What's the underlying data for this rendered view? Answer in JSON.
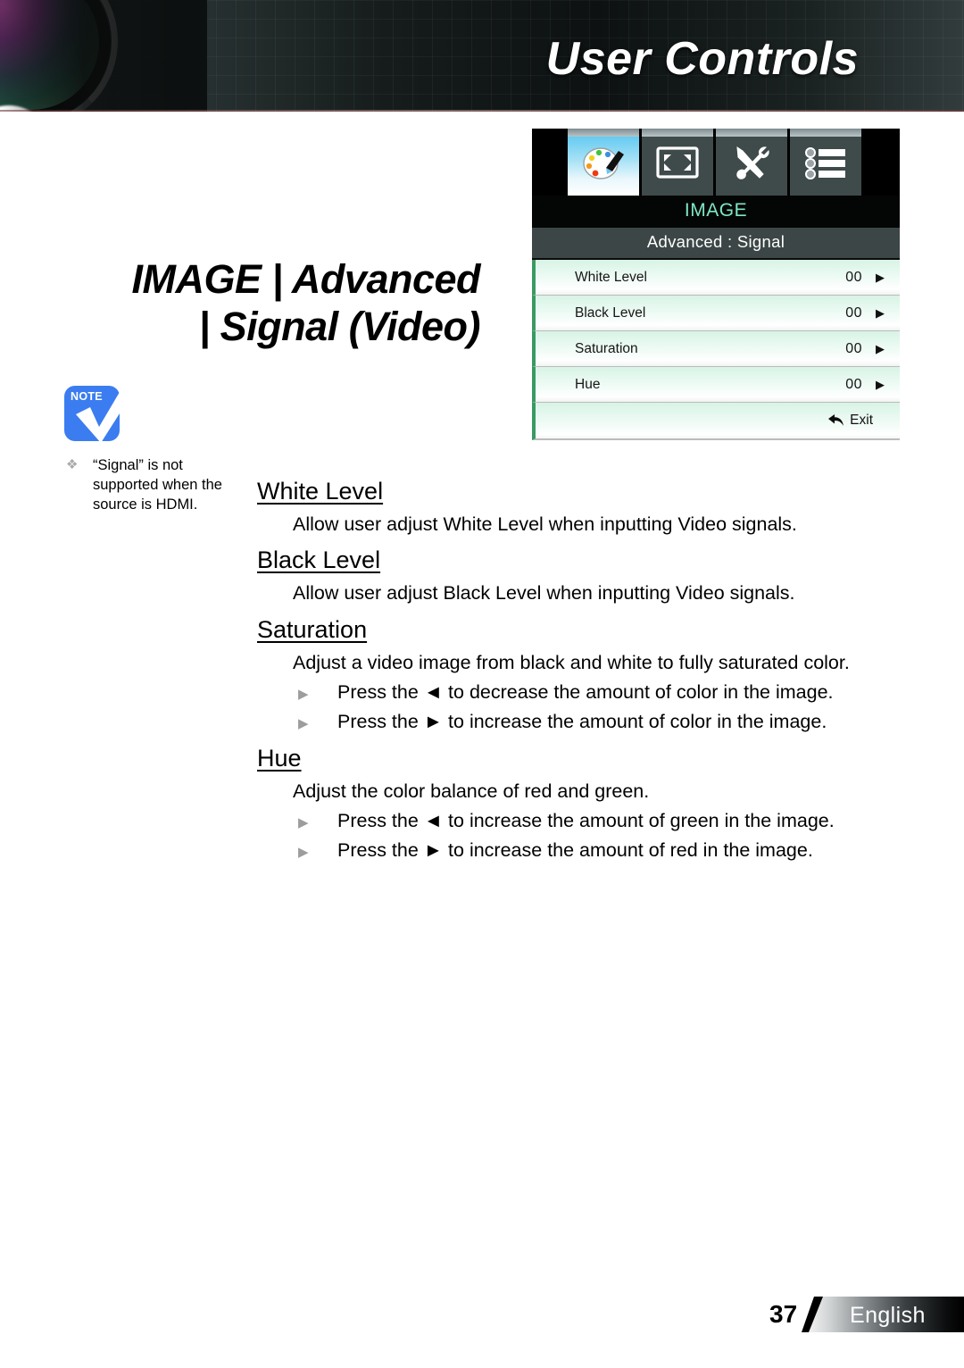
{
  "header": {
    "banner_title": "User Controls"
  },
  "page_title": {
    "line1": "IMAGE | Advanced",
    "line2": "| Signal (Video)"
  },
  "note": {
    "badge_label": "Note",
    "bullet_glyph": "❖",
    "text": "“Signal” is not supported when the source is HDMI."
  },
  "osd": {
    "tabs": [
      {
        "icon": "palette-icon",
        "label": "IMAGE",
        "active": true
      },
      {
        "icon": "screen-icon",
        "label": "DISPLAY",
        "active": false
      },
      {
        "icon": "tools-icon",
        "label": "SETUP",
        "active": false
      },
      {
        "icon": "options-list-icon",
        "label": "OPTIONS",
        "active": false
      }
    ],
    "title": "IMAGE",
    "subtitle": "Advanced : Signal",
    "rows": [
      {
        "label": "White Level",
        "value": "00",
        "arrow": "▶"
      },
      {
        "label": "Black Level",
        "value": "00",
        "arrow": "▶"
      },
      {
        "label": "Saturation",
        "value": "00",
        "arrow": "▶"
      },
      {
        "label": "Hue",
        "value": "00",
        "arrow": "▶"
      }
    ],
    "exit_label": "Exit"
  },
  "sections": [
    {
      "heading": "White Level",
      "description": "Allow user adjust White Level when inputting Video signals.",
      "bullets": []
    },
    {
      "heading": "Black Level",
      "description": "Allow user adjust Black Level when inputting Video signals.",
      "bullets": []
    },
    {
      "heading": "Saturation",
      "description": "Adjust a video image from black and white to fully saturated color.",
      "bullets": [
        "Press the ◄ to decrease the amount of color in the image.",
        "Press the ► to increase the amount of color in the image."
      ]
    },
    {
      "heading": "Hue",
      "description": "Adjust the color balance of red and green.",
      "bullets": [
        "Press the ◄ to increase the amount of green in the image.",
        "Press the ► to increase the amount of red in the image."
      ]
    }
  ],
  "footer": {
    "page_number": "37",
    "language": "English"
  },
  "colors": {
    "note_badge": "#3b7df0",
    "osd_title": "#7fe6c4",
    "osd_row_accent": "#3a9a63",
    "banner_dark": "#0d1111"
  }
}
